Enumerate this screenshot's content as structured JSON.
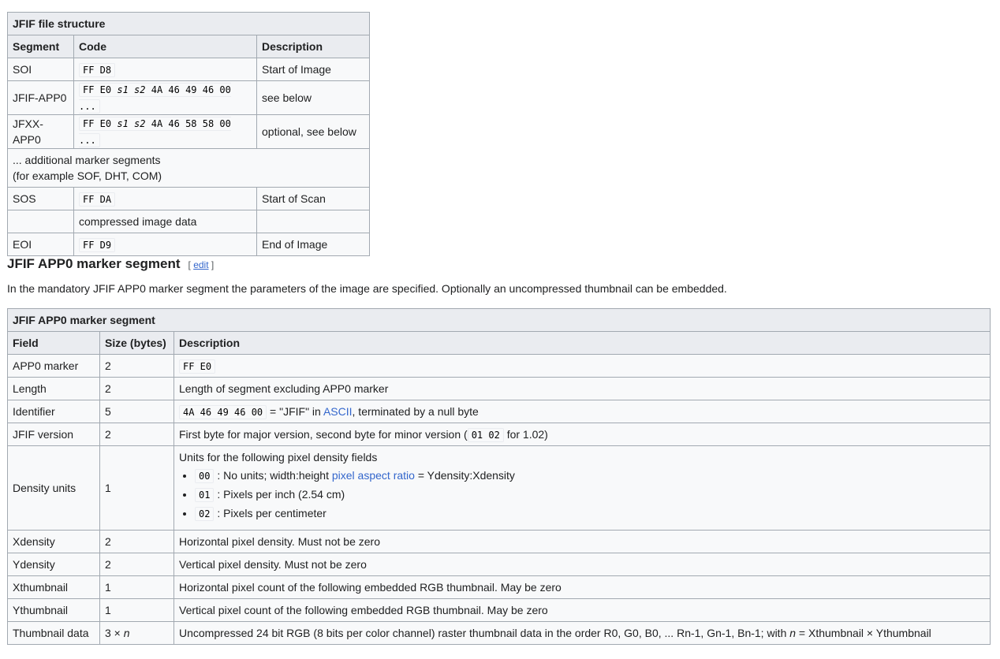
{
  "file_structure": {
    "caption": "JFIF file structure",
    "headers": [
      "Segment",
      "Code",
      "Description"
    ],
    "rows": [
      {
        "segment": "SOI",
        "code": "FF D8",
        "description": "Start of Image"
      },
      {
        "segment": "JFIF-APP0",
        "code_pre": "FF E0 ",
        "code_s1": "s1",
        "code_s2": "s2",
        "code_post": " 4A 46 49 46 00 ...",
        "description": "see below"
      },
      {
        "segment": "JFXX-APP0",
        "code_pre": "FF E0 ",
        "code_s1": "s1",
        "code_s2": "s2",
        "code_post": " 4A 46 58 58 00 ...",
        "description": "optional, see below"
      },
      {
        "note_line1": "... additional marker segments",
        "note_line2": "(for example SOF, DHT, COM)"
      },
      {
        "segment": "SOS",
        "code": "FF DA",
        "description": "Start of Scan"
      },
      {
        "segment": "",
        "code_text": "compressed image data",
        "description": ""
      },
      {
        "segment": "EOI",
        "code": "FF D9",
        "description": "End of Image"
      }
    ]
  },
  "section": {
    "heading": "JFIF APP0 marker segment",
    "edit_open": "[ ",
    "edit_label": "edit",
    "edit_close": " ]",
    "intro": "In the mandatory JFIF APP0 marker segment the parameters of the image are specified. Optionally an uncompressed thumbnail can be embedded."
  },
  "app0": {
    "caption": "JFIF APP0 marker segment",
    "headers": [
      "Field",
      "Size (bytes)",
      "Description"
    ],
    "rows": [
      {
        "field": "APP0 marker",
        "size": "2",
        "code": "FF E0"
      },
      {
        "field": "Length",
        "size": "2",
        "description": "Length of segment excluding APP0 marker"
      },
      {
        "field": "Identifier",
        "size": "5",
        "code": "4A 46 49 46 00",
        "desc_a": " = \"JFIF\" in ",
        "link": "ASCII",
        "desc_b": ", terminated by a null byte"
      },
      {
        "field": "JFIF version",
        "size": "2",
        "desc_a": "First byte for major version, second byte for minor version (",
        "code": "01 02",
        "desc_b": " for 1.02)"
      },
      {
        "field": "Density units",
        "size": "1",
        "desc_intro": "Units for the following pixel density fields",
        "items": [
          {
            "code": "00",
            "text_a": " : No units; width:height ",
            "link": "pixel aspect ratio",
            "text_b": " = Ydensity:Xdensity"
          },
          {
            "code": "01",
            "text": " : Pixels per inch (2.54 cm)"
          },
          {
            "code": "02",
            "text": " : Pixels per centimeter"
          }
        ]
      },
      {
        "field": "Xdensity",
        "size": "2",
        "description": "Horizontal pixel density. Must not be zero"
      },
      {
        "field": "Ydensity",
        "size": "2",
        "description": "Vertical pixel density. Must not be zero"
      },
      {
        "field": "Xthumbnail",
        "size": "1",
        "description": "Horizontal pixel count of the following embedded RGB thumbnail. May be zero"
      },
      {
        "field": "Ythumbnail",
        "size": "1",
        "description": "Vertical pixel count of the following embedded RGB thumbnail. May be zero"
      },
      {
        "field": "Thumbnail data",
        "size_a": "3 × ",
        "size_n": "n",
        "desc_a": "Uncompressed 24 bit RGB (8 bits per color channel) raster thumbnail data in the order R0, G0, B0, ... Rn-1, Gn-1, Bn-1; with ",
        "desc_n": "n",
        "desc_b": " = Xthumbnail × Ythumbnail"
      }
    ]
  }
}
